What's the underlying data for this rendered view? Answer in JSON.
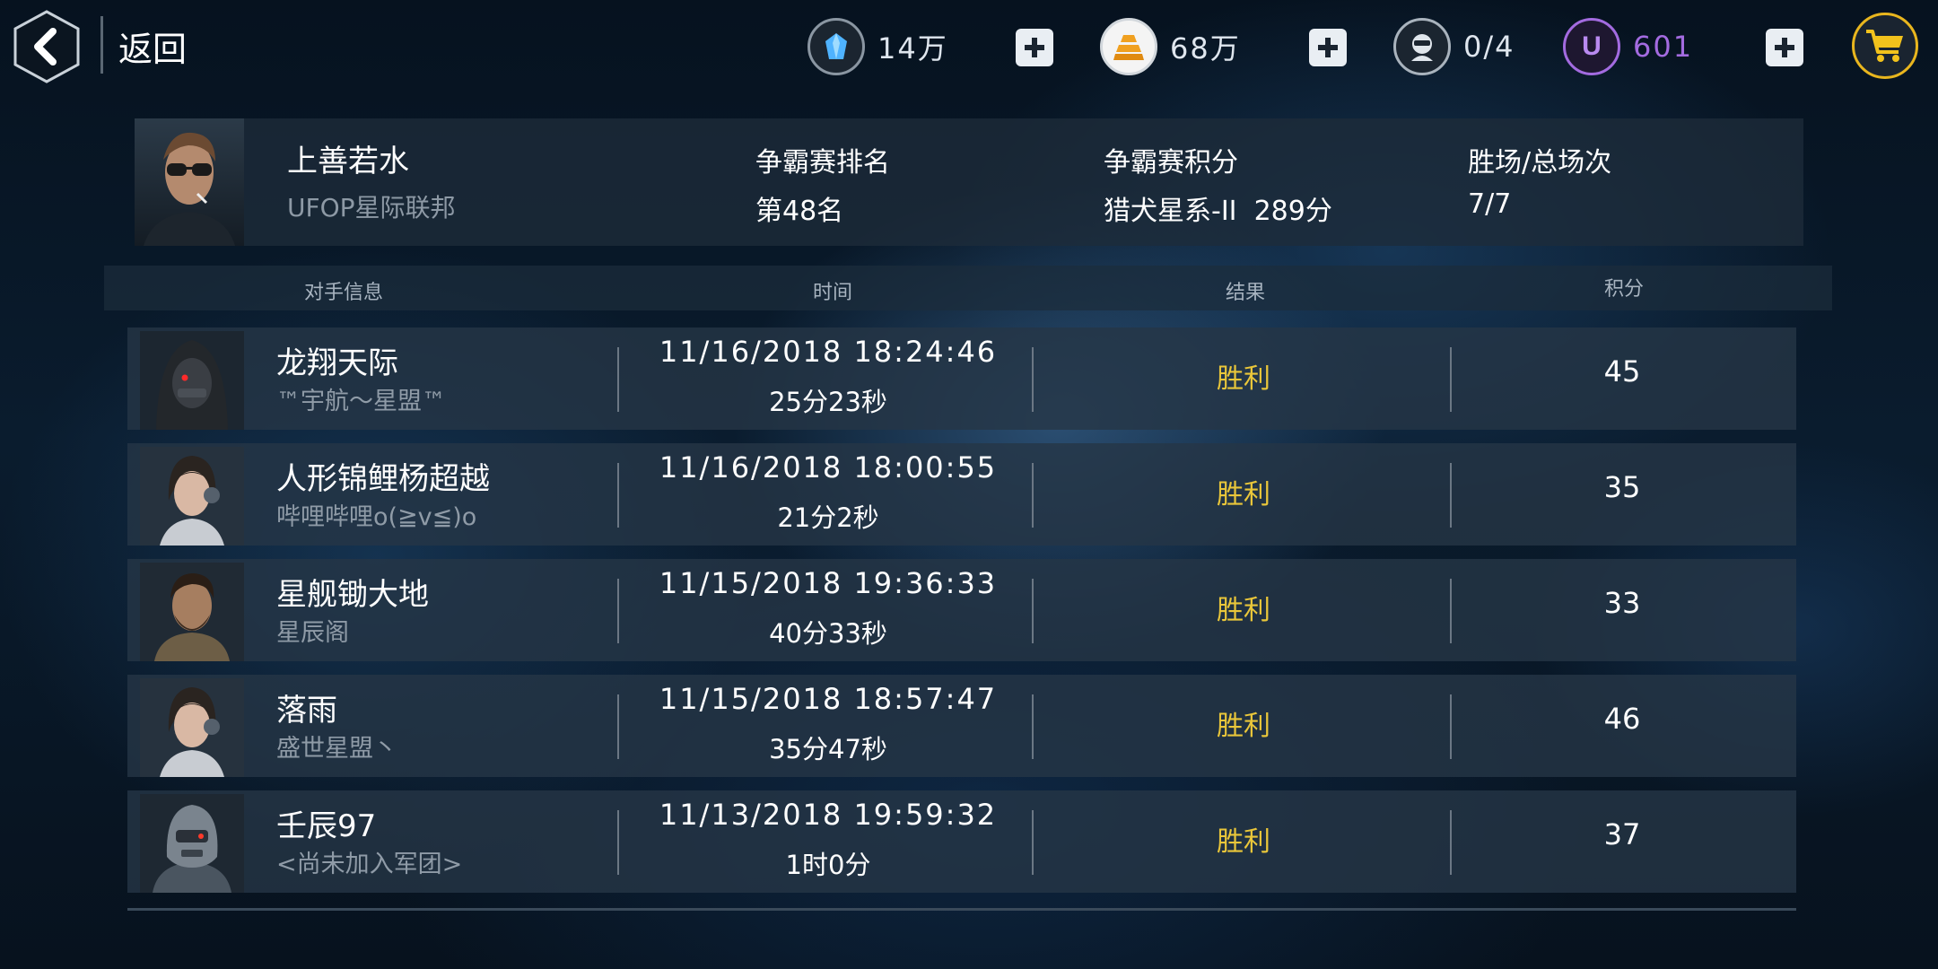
{
  "topbar": {
    "back_label": "返回",
    "resources": [
      {
        "name": "crystal",
        "value": "14万",
        "icon": "crystal-icon",
        "color": "#4fb3ff"
      },
      {
        "name": "gold",
        "value": "68万",
        "icon": "gold-bars-icon",
        "color": "#f0a020"
      },
      {
        "name": "pilot",
        "value": "0/4",
        "icon": "pilot-icon",
        "color": "#e0e6ec"
      },
      {
        "name": "u-credit",
        "value": "601",
        "icon": "u-coin-icon",
        "color": "#a36be0"
      }
    ]
  },
  "player": {
    "name": "上善若水",
    "legion": "UFOP星际联邦",
    "rank_label": "争霸赛排名",
    "rank_value": "第48名",
    "points_label": "争霸赛积分",
    "points_value": "猎犬星系-II  289分",
    "wins_label": "胜场/总场次",
    "wins_value": "7/7"
  },
  "table": {
    "headers": {
      "opponent": "对手信息",
      "time": "时间",
      "result": "结果",
      "score": "积分"
    },
    "rows": [
      {
        "name": "龙翔天际",
        "legion": "™宇航～星盟™",
        "datetime": "11/16/2018 18:24:46",
        "duration": "25分23秒",
        "result": "胜利",
        "score": "45",
        "avatar": "hooded-avatar"
      },
      {
        "name": "人形锦鲤杨超越",
        "legion": "哔哩哔哩o(≧v≦)o",
        "datetime": "11/16/2018 18:00:55",
        "duration": "21分2秒",
        "result": "胜利",
        "score": "35",
        "avatar": "female-pilot-avatar"
      },
      {
        "name": "星舰锄大地",
        "legion": "星辰阁",
        "datetime": "11/15/2018 19:36:33",
        "duration": "40分33秒",
        "result": "胜利",
        "score": "33",
        "avatar": "bearded-avatar"
      },
      {
        "name": "落雨",
        "legion": "盛世星盟丶",
        "datetime": "11/15/2018 18:57:47",
        "duration": "35分47秒",
        "result": "胜利",
        "score": "46",
        "avatar": "female-pilot-avatar"
      },
      {
        "name": "壬辰97",
        "legion": "<尚未加入军团>",
        "datetime": "11/13/2018 19:59:32",
        "duration": "1时0分",
        "result": "胜利",
        "score": "37",
        "avatar": "robot-avatar"
      }
    ]
  },
  "colors": {
    "win": "#e9c63a",
    "panel": "#26364a"
  }
}
